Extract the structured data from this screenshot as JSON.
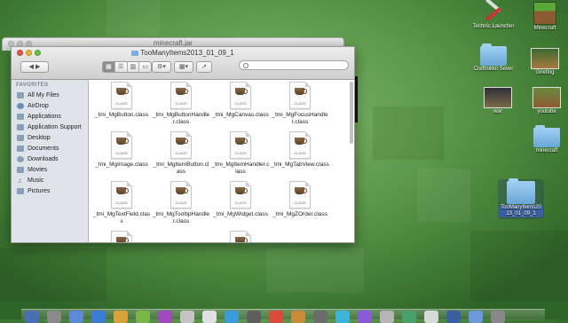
{
  "back_window": {
    "title": "minecraft.jar"
  },
  "window": {
    "title": "TooManyItems2013_01_09_1",
    "search_placeholder": "",
    "sidebar": {
      "heading": "FAVORITES",
      "items": [
        {
          "label": "All My Files",
          "icon": "all-files-icon"
        },
        {
          "label": "AirDrop",
          "icon": "airdrop-icon"
        },
        {
          "label": "Applications",
          "icon": "applications-icon"
        },
        {
          "label": "Application Support",
          "icon": "folder-icon"
        },
        {
          "label": "Desktop",
          "icon": "desktop-icon"
        },
        {
          "label": "Documents",
          "icon": "documents-icon"
        },
        {
          "label": "Downloads",
          "icon": "downloads-icon"
        },
        {
          "label": "Movies",
          "icon": "movies-icon"
        },
        {
          "label": "Music",
          "icon": "music-icon"
        },
        {
          "label": "Pictures",
          "icon": "pictures-icon"
        }
      ]
    },
    "files": [
      {
        "name": "_tmi_MgButton.class",
        "kind": "CLASS"
      },
      {
        "name": "_tmi_MgButtonHandler.class",
        "kind": "CLASS"
      },
      {
        "name": "_tmi_MgCanvas.class",
        "kind": "CLASS"
      },
      {
        "name": "_tmi_MgFocusHandler.class",
        "kind": "CLASS"
      },
      {
        "name": "_tmi_MgImage.class",
        "kind": "CLASS"
      },
      {
        "name": "_tmi_MgItemButton.class",
        "kind": "CLASS"
      },
      {
        "name": "_tmi_MgItemHandler.class",
        "kind": "CLASS"
      },
      {
        "name": "_tmi_MgTabView.class",
        "kind": "CLASS"
      },
      {
        "name": "_tmi_MgTextField.class",
        "kind": "CLASS"
      },
      {
        "name": "_tmi_MgTooltipHandler.class",
        "kind": "CLASS"
      },
      {
        "name": "_tmi_MgWidget.class",
        "kind": "CLASS"
      },
      {
        "name": "_tmi_MgZOrder.class",
        "kind": "CLASS"
      }
    ]
  },
  "desktop_icons": [
    {
      "label": "Technic Launcher",
      "icon": "technic-launcher-icon"
    },
    {
      "label": "Minecraft",
      "icon": "minecraft-icon"
    },
    {
      "label": "Craftrokkit Sever",
      "icon": "folder-icon"
    },
    {
      "label": "Griefing",
      "icon": "image-icon"
    },
    {
      "label": "war",
      "icon": "image-icon"
    },
    {
      "label": "youtube",
      "icon": "image-icon"
    },
    {
      "label": "minecraft",
      "icon": "folder-icon"
    },
    {
      "label": "TooManyItems2013_01_09_1",
      "icon": "folder-icon"
    }
  ],
  "colors": {
    "desktop_green": "#5e9a4c",
    "folder_blue": "#79aee0",
    "sidebar_bg": "#dfe4ea",
    "selection": "#3a5f9e"
  }
}
